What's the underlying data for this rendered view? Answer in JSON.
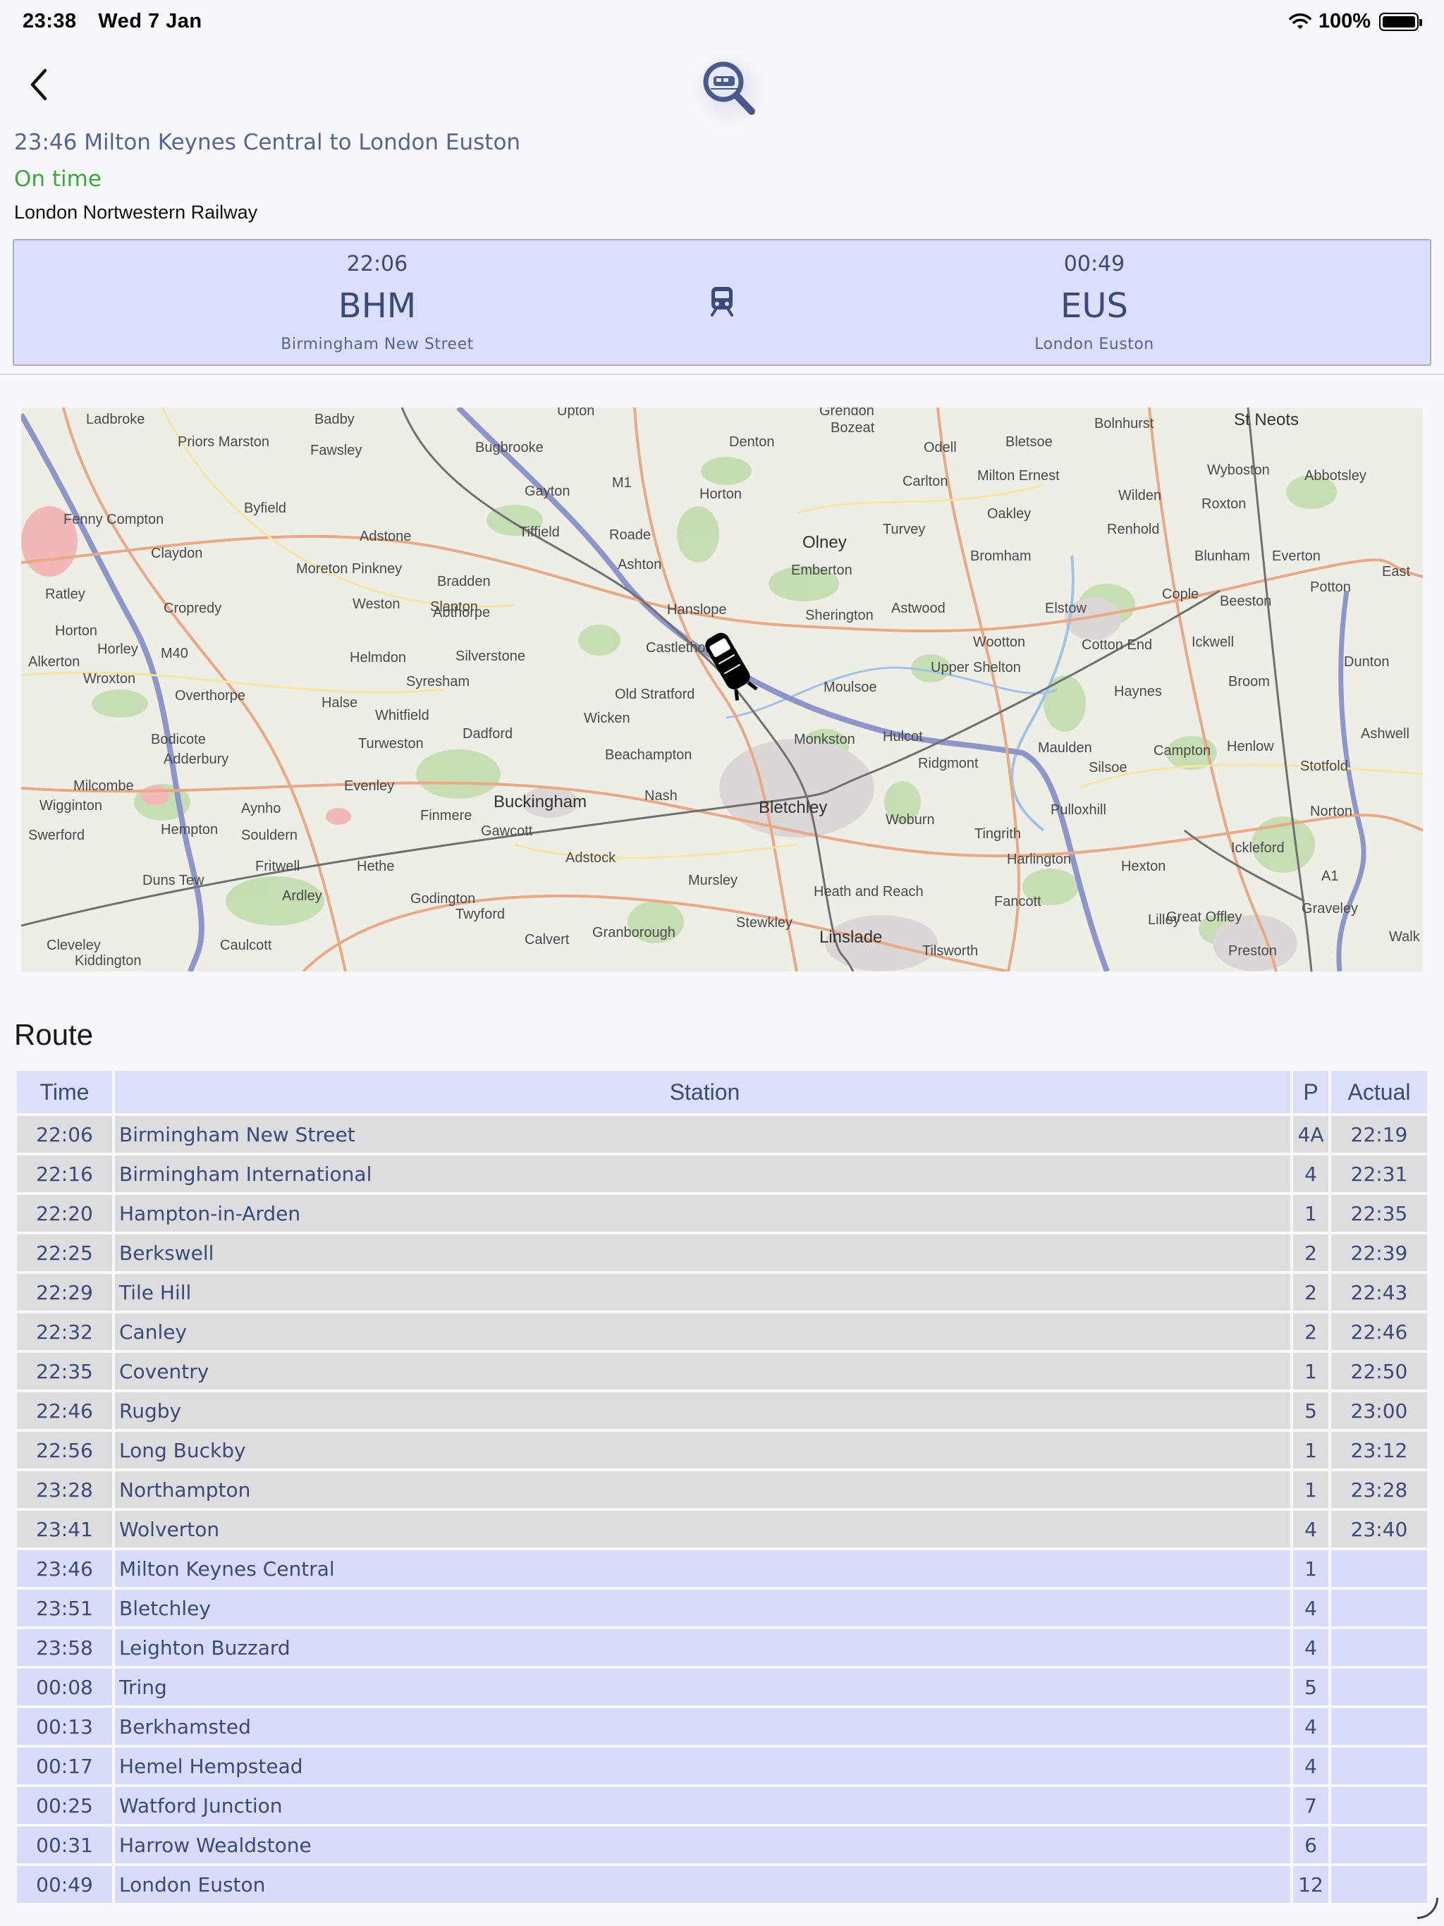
{
  "status_bar": {
    "time": "23:38",
    "date": "Wed 7 Jan",
    "battery": "100%"
  },
  "header": {
    "title": "23:46 Milton Keynes Central to London Euston",
    "status": "On time",
    "operator": "London Nortwestern Railway"
  },
  "journey": {
    "origin": {
      "time": "22:06",
      "code": "BHM",
      "name": "Birmingham New Street"
    },
    "destination": {
      "time": "00:49",
      "code": "EUS",
      "name": "London Euston"
    },
    "mode_icon": "train-icon"
  },
  "map": {
    "labels": [
      "Ladbroke",
      "Priors Marston",
      "Badby",
      "Fawsley",
      "Bugbrooke",
      "Upton",
      "Grendon",
      "Bozeat",
      "Denton",
      "Odell",
      "Bletsoe",
      "Bolnhurst",
      "St Neots",
      "Fenny Compton",
      "Byfield",
      "Claydon",
      "Adstone",
      "Gayton",
      "M1",
      "Tiffield",
      "Horton",
      "Roade",
      "Carlton",
      "Milton Ernest",
      "Wyboston",
      "Abbotsley",
      "Wilden",
      "Roxton",
      "Oakley",
      "Moreton Pinkney",
      "Bradden",
      "Ashton",
      "Olney",
      "Turvey",
      "Emberton",
      "Bromham",
      "Renhold",
      "Blunham",
      "Everton",
      "East",
      "Ratley",
      "Cropredy",
      "Weston",
      "Slapton",
      "Abthorpe",
      "Hanslope",
      "Sherington",
      "Astwood",
      "Elstow",
      "Cople",
      "Beeston",
      "Potton",
      "Horton",
      "Horley",
      "M40",
      "Alkerton",
      "Wroxton",
      "Helmdon",
      "Silverstone",
      "Castlethorpe",
      "Wootton",
      "Cotton End",
      "Ickwell",
      "Dunton",
      "Upper Shelton",
      "Syresham",
      "Overthorpe",
      "Old Stratford",
      "Moulsoe",
      "Haynes",
      "Broom",
      "Halse",
      "Whitfield",
      "Wicken",
      "Bodicote",
      "Turweston",
      "Dadford",
      "Monkston",
      "Hulcot",
      "Maulden",
      "Campton",
      "Henlow",
      "Ashwell",
      "Adderbury",
      "Beachampton",
      "Ridgmont",
      "Silsoe",
      "Stotfold",
      "Milcombe",
      "Evenley",
      "Wigginton",
      "Aynho",
      "Finmere",
      "Buckingham",
      "Nash",
      "Bletchley",
      "Woburn",
      "Pulloxhill",
      "Norton",
      "Swerford",
      "Hempton",
      "Souldern",
      "Gawcott",
      "Tingrith",
      "Ickleford",
      "Adstock",
      "Harlington",
      "Hexton",
      "Fritwell",
      "Hethe",
      "Duns Tew",
      "Ardley",
      "Mursley",
      "Heath and Reach",
      "A1",
      "Fancott",
      "Godington",
      "Lilley",
      "Great Offley",
      "Graveley",
      "Twyford",
      "Stewkley",
      "Calvert",
      "Granborough",
      "Linslade",
      "Cleveley",
      "Caulcott",
      "Tilsworth",
      "Preston",
      "Kiddington",
      "Walk"
    ]
  },
  "route": {
    "heading": "Route",
    "columns": {
      "time": "Time",
      "station": "Station",
      "platform": "P",
      "actual": "Actual"
    },
    "rows": [
      {
        "time": "22:06",
        "station": "Birmingham New Street",
        "platform": "4A",
        "actual": "22:19",
        "state": "past"
      },
      {
        "time": "22:16",
        "station": "Birmingham International",
        "platform": "4",
        "actual": "22:31",
        "state": "past"
      },
      {
        "time": "22:20",
        "station": "Hampton-in-Arden",
        "platform": "1",
        "actual": "22:35",
        "state": "past"
      },
      {
        "time": "22:25",
        "station": "Berkswell",
        "platform": "2",
        "actual": "22:39",
        "state": "past"
      },
      {
        "time": "22:29",
        "station": "Tile Hill",
        "platform": "2",
        "actual": "22:43",
        "state": "past"
      },
      {
        "time": "22:32",
        "station": "Canley",
        "platform": "2",
        "actual": "22:46",
        "state": "past"
      },
      {
        "time": "22:35",
        "station": "Coventry",
        "platform": "1",
        "actual": "22:50",
        "state": "past"
      },
      {
        "time": "22:46",
        "station": "Rugby",
        "platform": "5",
        "actual": "23:00",
        "state": "past"
      },
      {
        "time": "22:56",
        "station": "Long Buckby",
        "platform": "1",
        "actual": "23:12",
        "state": "past"
      },
      {
        "time": "23:28",
        "station": "Northampton",
        "platform": "1",
        "actual": "23:28",
        "state": "past"
      },
      {
        "time": "23:41",
        "station": "Wolverton",
        "platform": "4",
        "actual": "23:40",
        "state": "past"
      },
      {
        "time": "23:46",
        "station": "Milton Keynes Central",
        "platform": "1",
        "actual": "",
        "state": "future"
      },
      {
        "time": "23:51",
        "station": "Bletchley",
        "platform": "4",
        "actual": "",
        "state": "future"
      },
      {
        "time": "23:58",
        "station": "Leighton Buzzard",
        "platform": "4",
        "actual": "",
        "state": "future"
      },
      {
        "time": "00:08",
        "station": "Tring",
        "platform": "5",
        "actual": "",
        "state": "future"
      },
      {
        "time": "00:13",
        "station": "Berkhamsted",
        "platform": "4",
        "actual": "",
        "state": "future"
      },
      {
        "time": "00:17",
        "station": "Hemel Hempstead",
        "platform": "4",
        "actual": "",
        "state": "future"
      },
      {
        "time": "00:25",
        "station": "Watford Junction",
        "platform": "7",
        "actual": "",
        "state": "future"
      },
      {
        "time": "00:31",
        "station": "Harrow  Wealdstone",
        "platform": "6",
        "actual": "",
        "state": "future"
      },
      {
        "time": "00:49",
        "station": "London Euston",
        "platform": "12",
        "actual": "",
        "state": "future"
      }
    ]
  },
  "colors": {
    "accent": "#3b4a78",
    "on_time": "#3ea83e",
    "card_bg": "#dbdffb",
    "past_row": "#dddddf",
    "future_row": "#d8dcf8"
  }
}
